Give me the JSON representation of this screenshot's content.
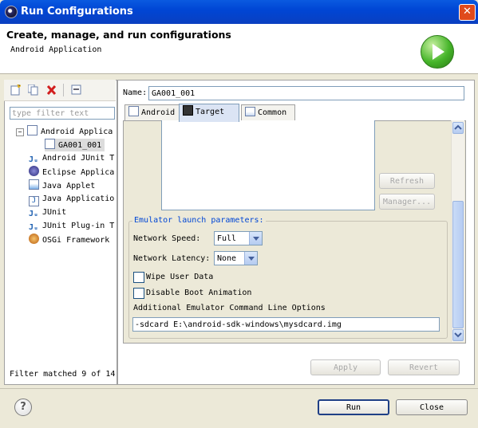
{
  "window": {
    "title": "Run Configurations"
  },
  "header": {
    "title": "Create, manage, and run configurations",
    "subtitle": "Android Application"
  },
  "left": {
    "filter_placeholder": "type filter text",
    "tree": [
      {
        "label": "Android Applica",
        "level": 0,
        "icon": "android-app-icon",
        "expanded": true
      },
      {
        "label": "GA001_001",
        "level": 1,
        "icon": "android-config-icon",
        "selected": true
      },
      {
        "label": "Android JUnit T",
        "level": 0,
        "icon": "junit-icon"
      },
      {
        "label": "Eclipse Applica",
        "level": 0,
        "icon": "eclipse-icon"
      },
      {
        "label": "Java Applet",
        "level": 0,
        "icon": "java-applet-icon"
      },
      {
        "label": "Java Applicatio",
        "level": 0,
        "icon": "java-app-icon"
      },
      {
        "label": "JUnit",
        "level": 0,
        "icon": "junit-icon"
      },
      {
        "label": "JUnit Plug-in T",
        "level": 0,
        "icon": "junit-plugin-icon"
      },
      {
        "label": "OSGi Framework",
        "level": 0,
        "icon": "osgi-icon"
      }
    ],
    "filter_status": "Filter matched 9 of 14"
  },
  "right": {
    "name_label": "Name:",
    "name_value": "GA001_001",
    "tabs": [
      {
        "label": "Android",
        "active": false
      },
      {
        "label": "Target",
        "active": true
      },
      {
        "label": "Common",
        "active": false
      }
    ],
    "refresh_label": "Refresh",
    "manager_label": "Manager...",
    "emulator": {
      "legend": "Emulator launch parameters:",
      "network_speed_label": "Network Speed:",
      "network_speed_value": "Full",
      "network_latency_label": "Network Latency:",
      "network_latency_value": "None",
      "wipe_user_data_label": "Wipe User Data",
      "wipe_user_data_checked": false,
      "disable_boot_label": "Disable Boot Animation",
      "disable_boot_checked": false,
      "cmdline_label": "Additional Emulator Command Line Options",
      "cmdline_value": "-sdcard E:\\android-sdk-windows\\mysdcard.img"
    },
    "apply_label": "Apply",
    "revert_label": "Revert"
  },
  "footer": {
    "run_label": "Run",
    "close_label": "Close"
  },
  "colors": {
    "titlebar": "#0046d5",
    "run_green": "#46b52a",
    "legend_blue": "#0046d5"
  }
}
